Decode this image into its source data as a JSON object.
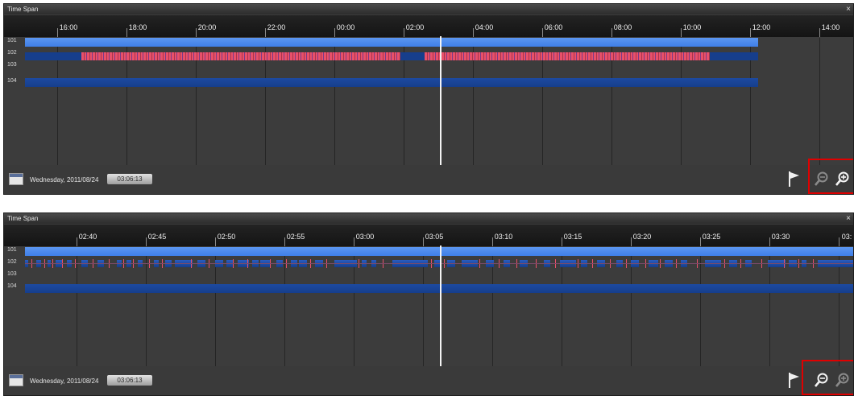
{
  "colors": {
    "panel_bg": "#3c3c3c",
    "ruler_bg": "#1a1a1a",
    "track_light_blue": "#3f7fe8",
    "track_dark_blue": "#163e8c",
    "event_red": "#e8506a",
    "cursor": "#f4f4f4",
    "highlight": "#e00000"
  },
  "panels": [
    {
      "title": "Time Span",
      "close_icon": "×",
      "ticks": [
        "16:00",
        "18:00",
        "20:00",
        "22:00",
        "00:00",
        "02:00",
        "04:00",
        "06:00",
        "08:00",
        "10:00",
        "12:00",
        "14:00"
      ],
      "channels": [
        "101",
        "102",
        "103",
        "104"
      ],
      "date": "Wednesday, 2011/08/24",
      "time": "03:06:13",
      "icons": [
        "calendar-icon",
        "flag-icon",
        "zoom-out-icon",
        "zoom-in-icon"
      ],
      "zoom_out_enabled": false,
      "zoom_in_enabled": true
    },
    {
      "title": "Time Span",
      "close_icon": "×",
      "ticks": [
        "02:40",
        "02:45",
        "02:50",
        "02:55",
        "03:00",
        "03:05",
        "03:10",
        "03:15",
        "03:20",
        "03:25",
        "03:30",
        "03:"
      ],
      "channels": [
        "101",
        "102",
        "103",
        "104"
      ],
      "date": "Wednesday, 2011/08/24",
      "time": "03:06:13",
      "icons": [
        "calendar-icon",
        "flag-icon",
        "zoom-out-icon",
        "zoom-in-icon"
      ],
      "zoom_out_enabled": true,
      "zoom_in_enabled": false
    }
  ]
}
